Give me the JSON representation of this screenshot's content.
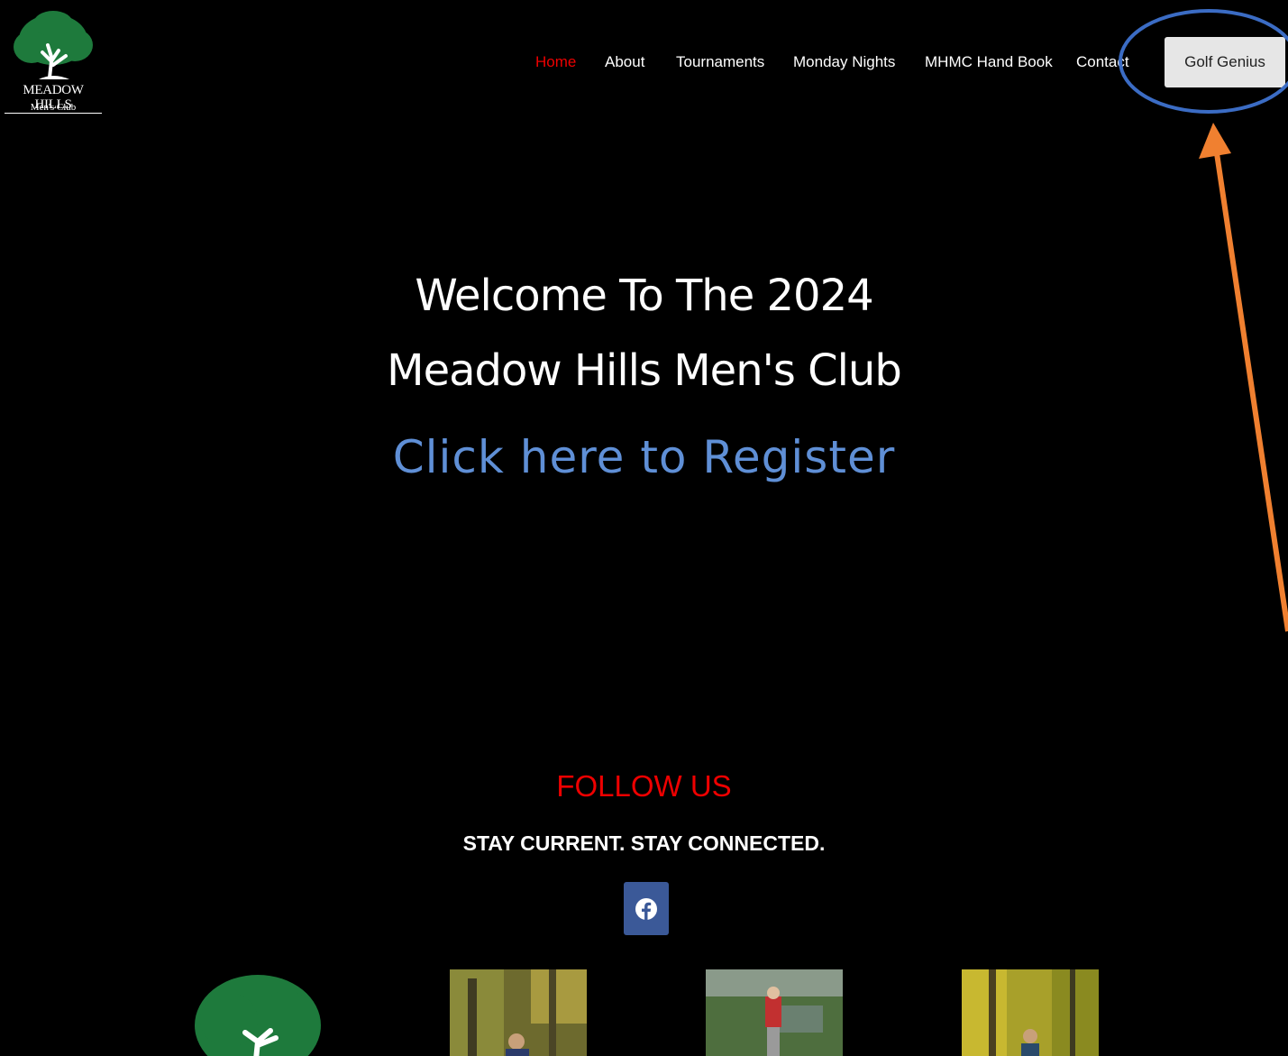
{
  "logo": {
    "title": "MEADOW HILLS",
    "subtitle": "Men's Club"
  },
  "nav": {
    "items": [
      {
        "label": "Home",
        "active": true
      },
      {
        "label": "About"
      },
      {
        "label": "Tournaments"
      },
      {
        "label": "Monday Nights"
      },
      {
        "label": "MHMC Hand Book"
      },
      {
        "label": "Contact"
      }
    ],
    "cta_label": "Golf Genius"
  },
  "hero": {
    "line1": "Welcome To The 2024",
    "line2": "Meadow Hills Men's Club",
    "register_link": "Click here to Register"
  },
  "follow": {
    "title": "FOLLOW US",
    "subtitle": "STAY CURRENT. STAY CONNECTED.",
    "social_icon": "facebook-icon"
  },
  "colors": {
    "background": "#000000",
    "nav_active": "#e00000",
    "register_link": "#5f8fd6",
    "follow_title": "#e00000",
    "facebook": "#3b5998",
    "cta_button": "#e6e6e6",
    "annotation_circle": "#3b6cc4",
    "annotation_arrow": "#f08030",
    "logo_tree": "#1e7a3c"
  }
}
